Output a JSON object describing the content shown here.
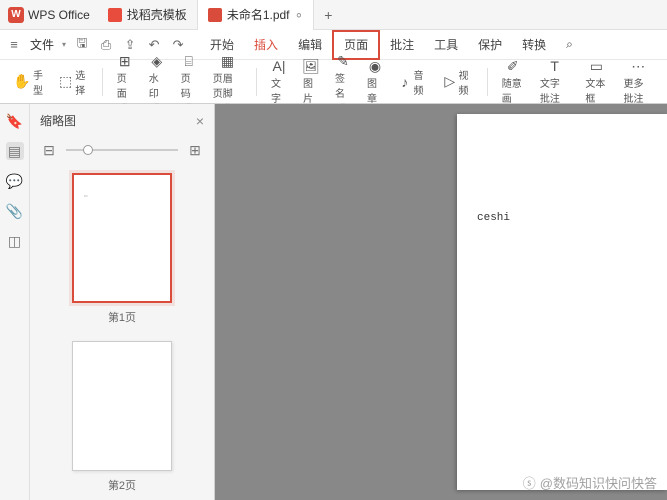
{
  "app": {
    "name": "WPS Office"
  },
  "tabs": [
    {
      "label": "找稻壳模板"
    },
    {
      "label": "未命名1.pdf"
    }
  ],
  "file_menu": "文件",
  "menu_tabs": {
    "start": "开始",
    "insert": "插入",
    "edit": "编辑",
    "page": "页面",
    "annotate": "批注",
    "tool": "工具",
    "protect": "保护",
    "convert": "转换"
  },
  "toolbar": {
    "hand": "手型",
    "select": "选择",
    "pagebg": "页面",
    "watermark": "水印",
    "pagenum": "页码",
    "bgcolor": "页眉页脚",
    "text": "文字",
    "image": "图片",
    "sign": "签名",
    "stamp": "图章",
    "audio": "音频",
    "video": "视频",
    "doodle": "随意画",
    "textanno": "文字批注",
    "textbox": "文本框",
    "moreanno": "更多批注"
  },
  "thumbs": {
    "title": "缩略图",
    "page1": "第1页",
    "page2": "第2页"
  },
  "page_content": "ceshi",
  "watermark_text": "@数码知识快问快答"
}
